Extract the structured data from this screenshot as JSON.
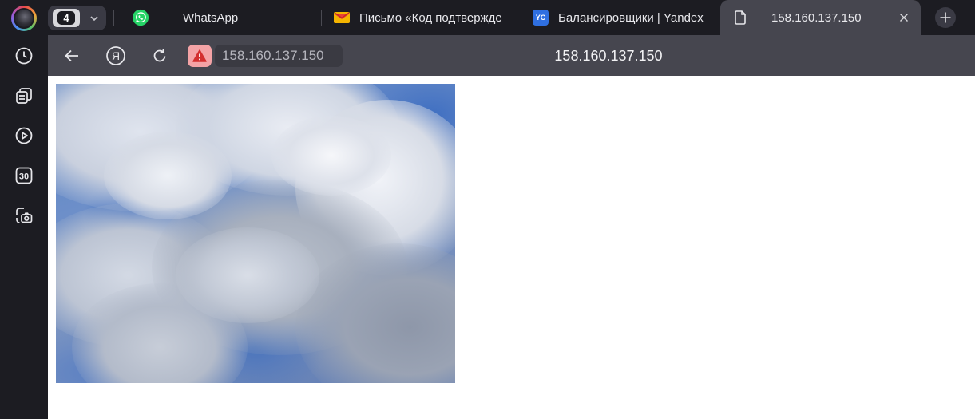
{
  "sidebar": {
    "items": [
      {
        "name": "history-icon"
      },
      {
        "name": "collections-icon"
      },
      {
        "name": "video-icon"
      },
      {
        "name": "calendar-icon",
        "label": "30"
      },
      {
        "name": "screenshot-icon"
      }
    ]
  },
  "tabs": {
    "count": "4",
    "items": [
      {
        "title": "WhatsApp",
        "icon": "whatsapp-icon"
      },
      {
        "title": "Письмо «Код подтвержде",
        "icon": "mail-icon"
      },
      {
        "title": "Балансировщики | Yandex",
        "icon": "yandex-cloud-icon",
        "icon_text": "YC"
      },
      {
        "title": "158.160.137.150",
        "icon": "page-icon",
        "active": true
      }
    ]
  },
  "toolbar": {
    "address": "158.160.137.150",
    "page_title": "158.160.137.150",
    "yandex_button": "Я"
  },
  "colors": {
    "chrome_dark": "#1c1c22",
    "toolbar": "#46464f",
    "security_warning": "#f4a3a6",
    "warning_red": "#d32f2f",
    "whatsapp_green": "#25d366"
  }
}
